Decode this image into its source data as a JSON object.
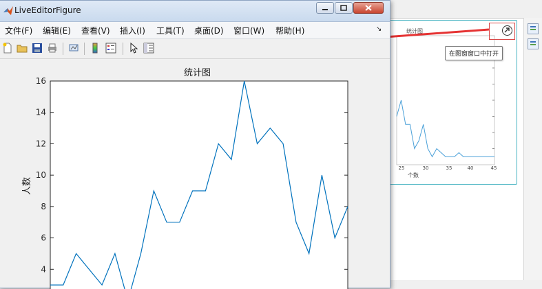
{
  "window": {
    "title": "LiveEditorFigure"
  },
  "menu": {
    "items": [
      {
        "label": "文件(F)"
      },
      {
        "label": "编辑(E)"
      },
      {
        "label": "查看(V)"
      },
      {
        "label": "插入(I)"
      },
      {
        "label": "工具(T)"
      },
      {
        "label": "桌面(D)"
      },
      {
        "label": "窗口(W)"
      },
      {
        "label": "帮助(H)"
      }
    ]
  },
  "toolbar": {
    "icons": [
      "new-file-icon",
      "open-folder-icon",
      "save-icon",
      "print-icon",
      "link-plot-icon",
      "colorbar-icon",
      "legend-icon",
      "pointer-icon",
      "property-inspector-icon"
    ]
  },
  "preview": {
    "title": "统计图",
    "xlabel": "个数",
    "ticks": [
      "25",
      "30",
      "35",
      "40",
      "45"
    ],
    "tooltip": "在图窗窗口中打开"
  },
  "colors": {
    "line": "#0072bd",
    "annotation": "#e53333",
    "accent_border": "#47b3c2"
  },
  "chart_data": {
    "type": "line",
    "title": "统计图",
    "xlabel": "",
    "ylabel": "人数",
    "ylim": [
      2,
      16
    ],
    "yticks": [
      "4",
      "6",
      "8",
      "10",
      "12",
      "14",
      "16"
    ],
    "x": [
      1,
      2,
      3,
      4,
      5,
      6,
      7,
      8,
      9,
      10,
      11,
      12,
      13,
      14,
      15,
      16,
      17,
      18,
      19,
      20,
      21,
      22,
      23,
      24,
      25,
      26,
      27,
      28,
      29,
      30,
      31,
      32,
      33,
      34,
      35,
      36,
      37,
      38,
      39,
      40,
      41,
      42,
      43,
      44,
      45
    ],
    "values": [
      3,
      3,
      5,
      4,
      3,
      5,
      2,
      5,
      9,
      7,
      7,
      9,
      9,
      12,
      11,
      16,
      12,
      13,
      12,
      7,
      5,
      10,
      6,
      8,
      5,
      5,
      2,
      3,
      5,
      2,
      1,
      2,
      1.5,
      1,
      1,
      1,
      1.5,
      1,
      1,
      1,
      1,
      1,
      1,
      1,
      1
    ]
  }
}
